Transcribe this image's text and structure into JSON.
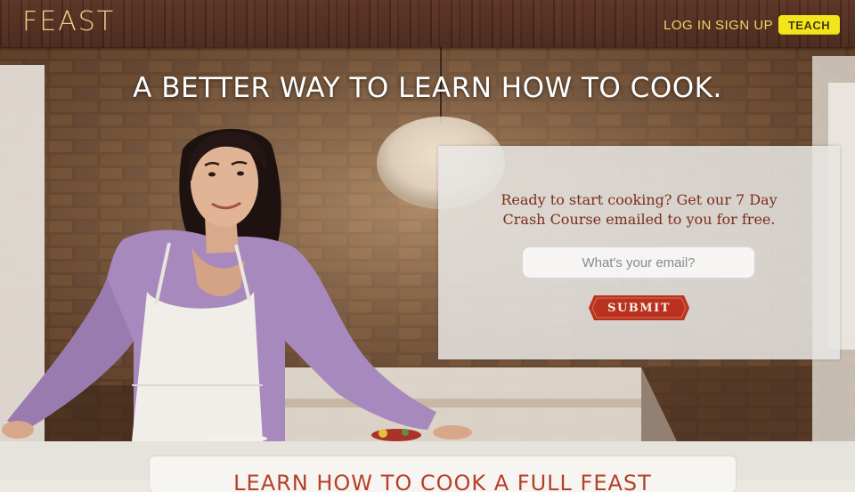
{
  "header": {
    "logo": "FEAST",
    "nav": {
      "login": "LOG IN",
      "signup": "SIGN UP",
      "teach": "TEACH"
    }
  },
  "hero": {
    "title": "A BETTER WAY TO LEARN HOW TO COOK.",
    "image": "woman-in-apron-kitchen-photo"
  },
  "signup_panel": {
    "text_line1": "Ready to start cooking? Get our 7 Day",
    "text_line2": "Crash Course emailed to you for free.",
    "email_placeholder": "What's your email?",
    "email_value": "",
    "submit_label": "SUBMIT"
  },
  "lower": {
    "heading": "LEARN HOW TO COOK A FULL FEAST"
  },
  "colors": {
    "header_bg": "#4a281b",
    "logo": "#e6d38a",
    "nav_link": "#e8d96a",
    "teach_bg": "#f2e51b",
    "panel_text": "#7a2e1c",
    "submit_bg": "#b8321f",
    "lower_heading": "#b5402a"
  }
}
